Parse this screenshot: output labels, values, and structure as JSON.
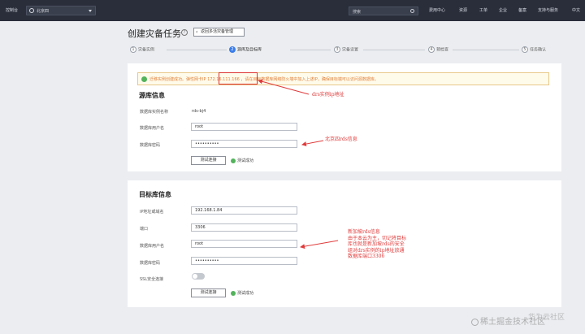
{
  "topbar": {
    "console": "控制台",
    "region": "北京四",
    "search_placeholder": "搜索",
    "items": [
      "费用中心",
      "资源",
      "工单",
      "企业",
      "备案",
      "支持与服务",
      "中文"
    ]
  },
  "page": {
    "title": "创建灾备任务",
    "back_label": "返回多活灾备管理"
  },
  "steps": [
    {
      "num": "1",
      "label": "灾备实例"
    },
    {
      "num": "2",
      "label": "源库及目标库"
    },
    {
      "num": "3",
      "label": "灾备设置"
    },
    {
      "num": "4",
      "label": "预检查"
    },
    {
      "num": "5",
      "label": "任务确认"
    }
  ],
  "alert": {
    "text": "迁移实例创建成功。弹性网卡IP 172.16.111.166 ，请在目标数据库网络防火墙中加入上述IP，确保目标端可以访问源数据库。"
  },
  "source": {
    "title": "源库信息",
    "instance_label": "数据库实例名称",
    "instance_value": "rds-bj4",
    "user_label": "数据库用户名",
    "user_value": "root",
    "password_label": "数据库密码",
    "password_value": "••••••••••",
    "test_button": "测试连接",
    "test_result": "测试成功"
  },
  "target": {
    "title": "目标库信息",
    "ip_label": "IP地址或域名",
    "ip_value": "192.168.1.84",
    "port_label": "端口",
    "port_value": "3306",
    "user_label": "数据库用户名",
    "user_value": "root",
    "password_label": "数据库密码",
    "password_value": "••••••••••",
    "ssl_label": "SSL安全连接",
    "test_button": "测试连接",
    "test_result": "测试成功"
  },
  "annotations": {
    "a1": "drs实例ip地址",
    "a2": "北京四rds信息",
    "a3_lines": [
      "新加坡rds信息",
      "由于本云为主，切记将目标",
      "库也就是新加坡rds的安全",
      "组对drs实例的ip地址放通",
      "数据库端口3306"
    ]
  },
  "watermark": {
    "text1": "稀土掘金技术社区",
    "text2": "华为云社区"
  },
  "colors": {
    "topbar": "#2a2e3b",
    "accent": "#3b7de9",
    "success": "#52b35b",
    "annotation": "#e03a3a",
    "alert_text": "#e0803a"
  }
}
